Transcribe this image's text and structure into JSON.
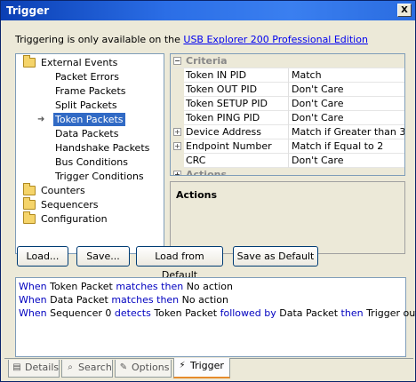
{
  "window": {
    "title": "Trigger",
    "close": "X"
  },
  "info": {
    "text": "Triggering is only available on the ",
    "link": "USB Explorer 200 Professional Edition"
  },
  "tree": {
    "external_events": "External Events",
    "children": [
      "Packet Errors",
      "Frame Packets",
      "Split Packets",
      "Token Packets",
      "Data Packets",
      "Handshake Packets",
      "Bus Conditions",
      "Trigger Conditions"
    ],
    "selected": "Token Packets",
    "roots": [
      "Counters",
      "Sequencers",
      "Configuration"
    ]
  },
  "grid": {
    "criteria": "Criteria",
    "rows": [
      {
        "name": "Token IN PID",
        "value": "Match"
      },
      {
        "name": "Token OUT PID",
        "value": "Don't Care"
      },
      {
        "name": "Token SETUP PID",
        "value": "Don't Care"
      },
      {
        "name": "Token PING PID",
        "value": "Don't Care"
      },
      {
        "name": "Device Address",
        "value": "Match if Greater than 3"
      },
      {
        "name": "Endpoint Number",
        "value": "Match if Equal to 2"
      },
      {
        "name": "CRC",
        "value": "Don't Care"
      }
    ],
    "actions": "Actions"
  },
  "description": {
    "title": "Actions"
  },
  "buttons": {
    "load": "Load...",
    "save": "Save...",
    "load_default": "Load from Default",
    "save_default": "Save as Default"
  },
  "summary": {
    "line1": {
      "w1": "When",
      "t1": "Token Packet",
      "w2": "matches then",
      "t2": "No action"
    },
    "line2": {
      "w1": "When",
      "t1": "Data Packet",
      "w2": "matches then",
      "t2": "No action"
    },
    "line3": {
      "w1": "When",
      "t1": "Sequencer 0",
      "w2": "detects",
      "t2": "Token Packet",
      "w3": "followed by",
      "t3": "Data Packet",
      "w4": "then",
      "t4": "Trigger out"
    }
  },
  "tabs": [
    "Details",
    "Search",
    "Options",
    "Trigger"
  ],
  "active_tab": "Trigger"
}
